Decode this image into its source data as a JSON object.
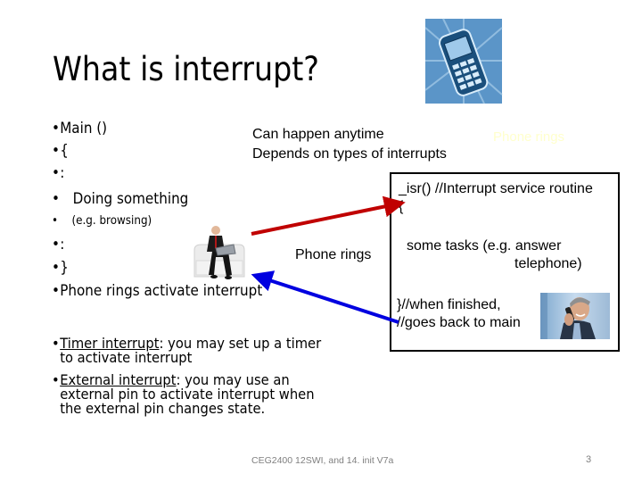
{
  "slide": {
    "title": "What is interrupt?",
    "main_code_bullets": [
      {
        "bullet": "•",
        "text": "Main ()"
      },
      {
        "bullet": "•",
        "text": "{"
      },
      {
        "bullet": "•",
        "text": ":"
      },
      {
        "bullet": "•",
        "text": "   Doing something"
      },
      {
        "bullet": "•",
        "text": "   (e.g. browsing)"
      },
      {
        "bullet": "•",
        "text": ":"
      },
      {
        "bullet": "•",
        "text": "}"
      },
      {
        "bullet": "•",
        "text": "Phone rings activate interrupt"
      }
    ],
    "notes": {
      "can_happen": "Can happen anytime",
      "depends_on": "Depends on types of interrupts",
      "phone_rings_faded": "Phone rings",
      "phone_rings": "Phone rings"
    },
    "isr_box": {
      "line1": "_isr() //Interrupt service routine",
      "line2": "{",
      "line3": "some tasks (e.g. answer",
      "line4": "telephone)",
      "line5": "}//when finished,",
      "line6": "//goes back to main"
    },
    "lower_bullets": [
      {
        "term": "Timer interrupt",
        "rest_line1": ": you may set up a timer",
        "rest_lines": [
          "to activate interrupt"
        ]
      },
      {
        "term": "External interrupt",
        "rest_line1": ": you may use an",
        "rest_lines": [
          "external pin to activate interrupt when",
          "the external pin changes state."
        ]
      }
    ],
    "images": {
      "phone_icon": "mobile-phone-clipart",
      "man_with_laptop": "man-on-sofa-with-laptop-photo",
      "man_on_phone": "man-talking-on-phone-photo"
    },
    "footer": {
      "course": "CEG2400 12SWI, and 14. init V7a",
      "page_number": "3"
    },
    "colors": {
      "call_arrow": "#c00000",
      "return_arrow": "#0000e0",
      "phone_bg": "#5b9bd5",
      "faded_text": "#ffffcc"
    }
  }
}
